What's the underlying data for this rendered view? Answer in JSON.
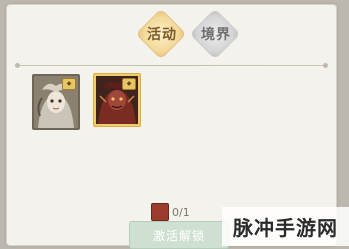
{
  "tabs": [
    {
      "label": "活动",
      "active": true
    },
    {
      "label": "境界",
      "active": false
    }
  ],
  "cards": [
    {
      "name": "character-card-1",
      "selected": false
    },
    {
      "name": "character-card-2",
      "selected": true
    }
  ],
  "cost": {
    "count": "0/1"
  },
  "activate_label": "激活解锁",
  "watermark": "脉冲手游网",
  "colors": {
    "accent_gold": "#f0cc6a",
    "button_green": "#cfe0d2"
  }
}
